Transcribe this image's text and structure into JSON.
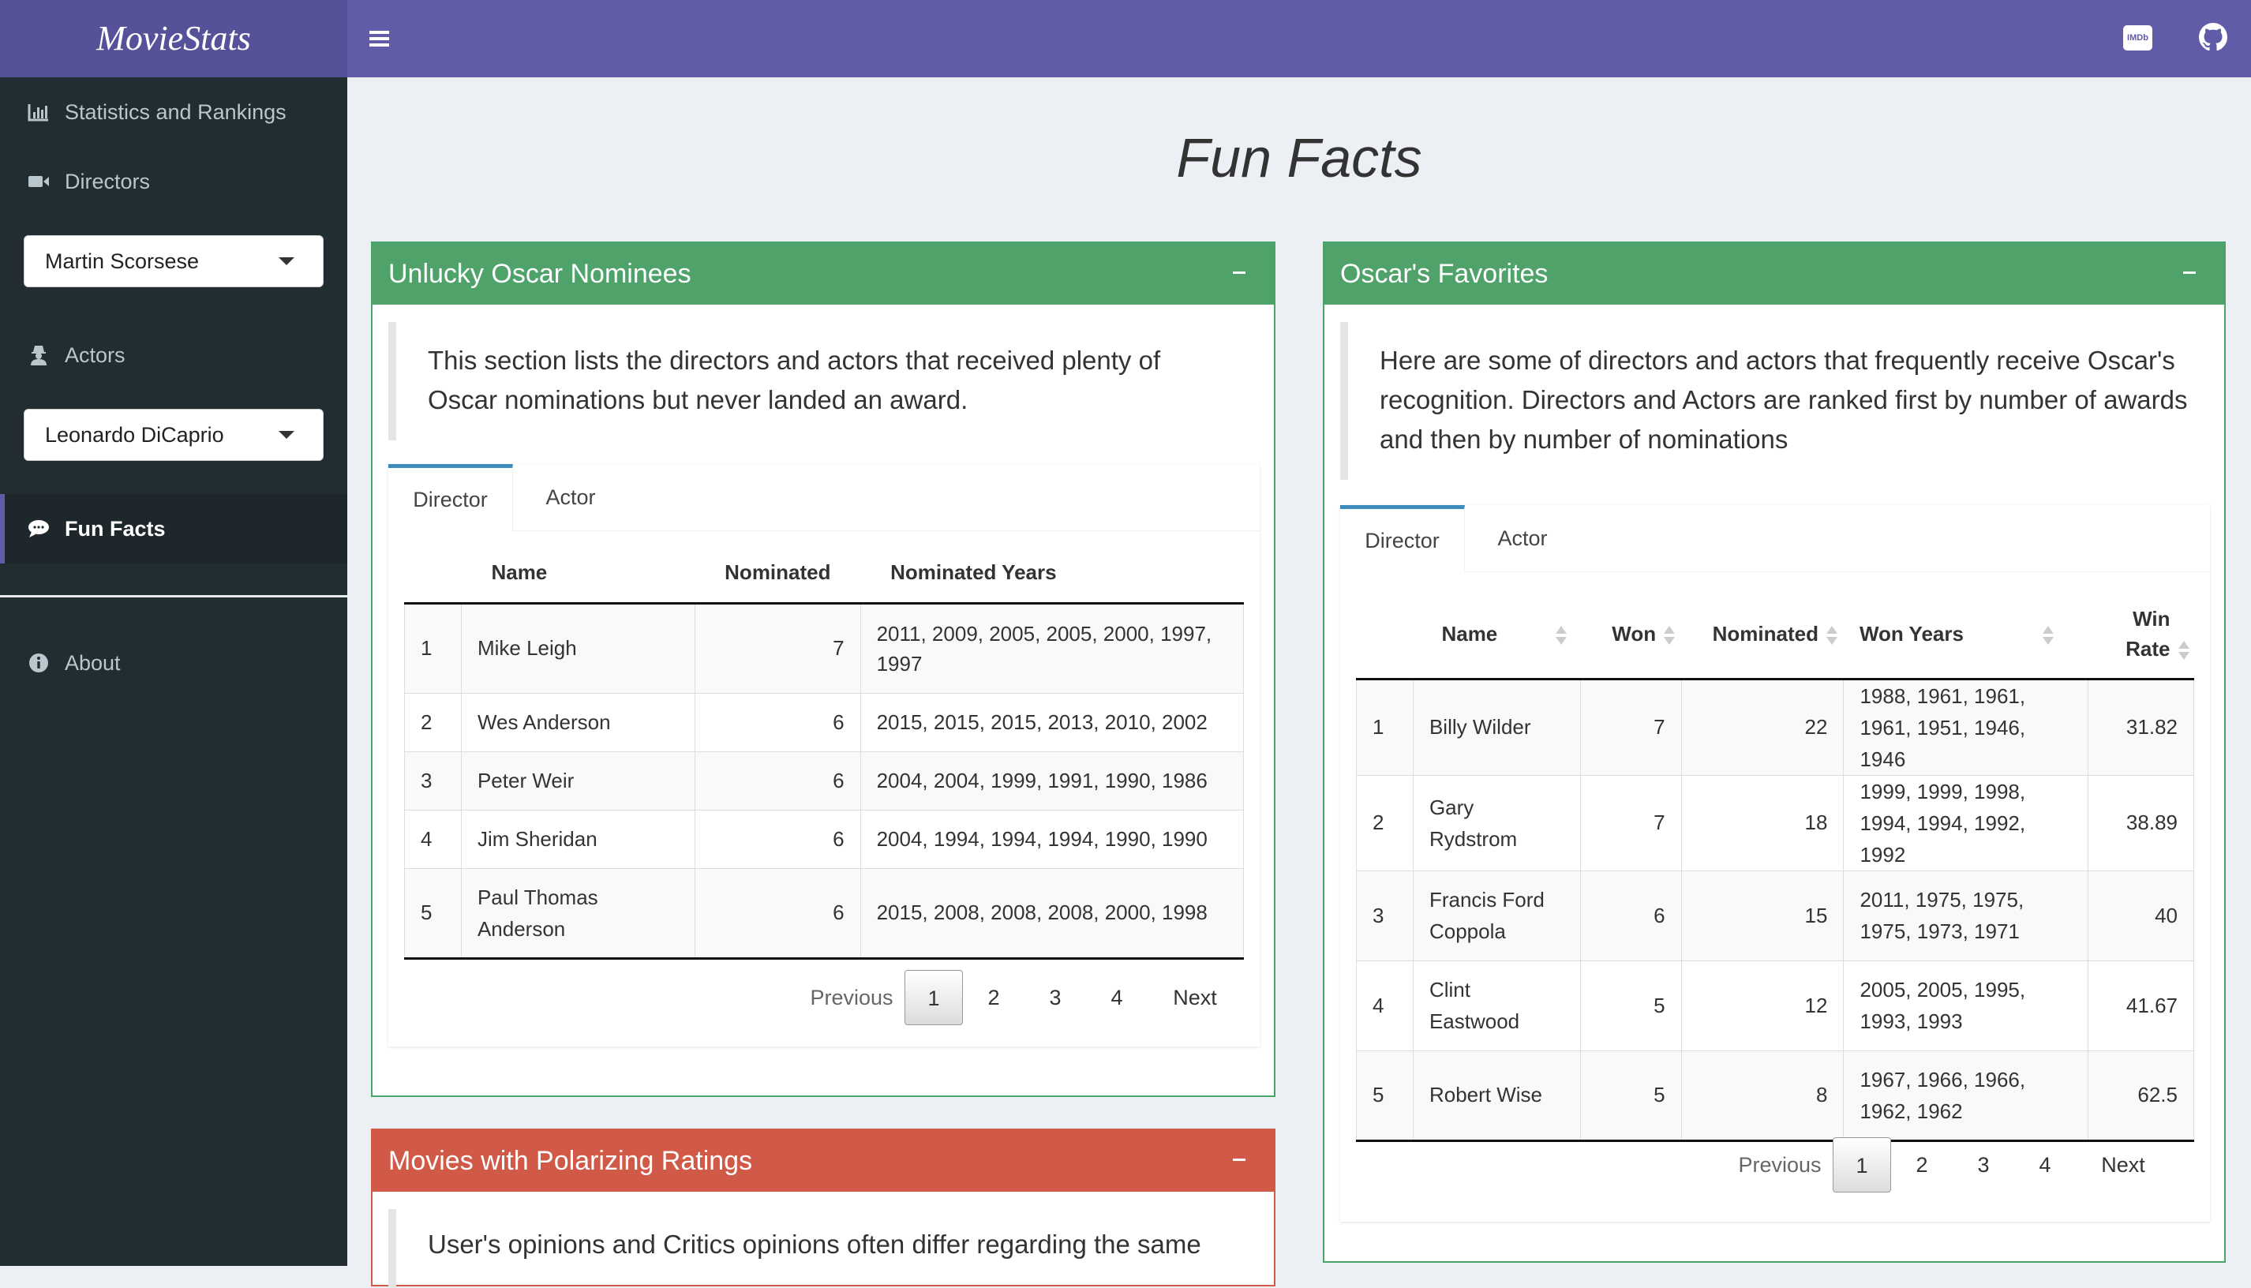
{
  "app": {
    "title": "MovieStats"
  },
  "sidebar": {
    "items": [
      {
        "label": "Statistics and Rankings",
        "icon": "bar-chart-icon"
      },
      {
        "label": "Directors",
        "icon": "video-camera-icon"
      },
      {
        "label": "Actors",
        "icon": "user-secret-icon"
      },
      {
        "label": "Fun Facts",
        "icon": "comments-icon",
        "active": true
      },
      {
        "label": "About",
        "icon": "info-circle-icon"
      }
    ],
    "director_select": {
      "value": "Martin Scorsese"
    },
    "actor_select": {
      "value": "Leonardo DiCaprio"
    }
  },
  "header": {
    "imdb_icon": "imdb-icon",
    "imdb_label": "IMDb",
    "github_icon": "github-icon",
    "menu_icon": "hamburger-icon"
  },
  "page": {
    "title": "Fun Facts"
  },
  "colors": {
    "header": "#605ca8",
    "logo_bg": "#555299",
    "sidebar": "#222d32",
    "success_box": "#4ea26a",
    "danger_box": "#d05a47",
    "tab_accent": "#3c8dbc"
  },
  "unlucky": {
    "title": "Unlucky Oscar Nominees",
    "description": "This section lists the directors and actors that received plenty of Oscar nominations but never landed an award.",
    "tabs": [
      "Director",
      "Actor"
    ],
    "columns": [
      "",
      "Name",
      "Nominated",
      "Nominated Years"
    ],
    "rows": [
      [
        "1",
        "Mike Leigh",
        "7",
        "2011, 2009, 2005, 2005, 2000, 1997, 1997"
      ],
      [
        "2",
        "Wes Anderson",
        "6",
        "2015, 2015, 2015, 2013, 2010, 2002"
      ],
      [
        "3",
        "Peter Weir",
        "6",
        "2004, 2004, 1999, 1991, 1990, 1986"
      ],
      [
        "4",
        "Jim Sheridan",
        "6",
        "2004, 1994, 1994, 1994, 1990, 1990"
      ],
      [
        "5",
        "Paul Thomas Anderson",
        "6",
        "2015, 2008, 2008, 2008, 2000, 1998"
      ]
    ],
    "pager": {
      "previous": "Previous",
      "pages": [
        "1",
        "2",
        "3",
        "4"
      ],
      "next": "Next"
    }
  },
  "favorites": {
    "title": "Oscar's Favorites",
    "description": "Here are some of directors and actors that frequently receive Oscar's recognition. Directors and Actors are ranked first by number of awards and then by number of nominations",
    "tabs": [
      "Director",
      "Actor"
    ],
    "columns": [
      "",
      "Name",
      "Won",
      "Nominated",
      "Won Years",
      "Win Rate"
    ],
    "rows": [
      [
        "1",
        "Billy Wilder",
        "7",
        "22",
        "1988, 1961, 1961, 1961, 1951, 1946, 1946",
        "31.82"
      ],
      [
        "2",
        "Gary Rydstrom",
        "7",
        "18",
        "1999, 1999, 1998, 1994, 1994, 1992, 1992",
        "38.89"
      ],
      [
        "3",
        "Francis Ford Coppola",
        "6",
        "15",
        "2011, 1975, 1975, 1975, 1973, 1971",
        "40"
      ],
      [
        "4",
        "Clint Eastwood",
        "5",
        "12",
        "2005, 2005, 1995, 1993, 1993",
        "41.67"
      ],
      [
        "5",
        "Robert Wise",
        "5",
        "8",
        "1967, 1966, 1966, 1962, 1962",
        "62.5"
      ]
    ],
    "pager": {
      "previous": "Previous",
      "pages": [
        "1",
        "2",
        "3",
        "4"
      ],
      "next": "Next"
    }
  },
  "polarizing": {
    "title": "Movies with Polarizing Ratings",
    "description": "User's opinions and Critics opinions often differ regarding the same"
  }
}
